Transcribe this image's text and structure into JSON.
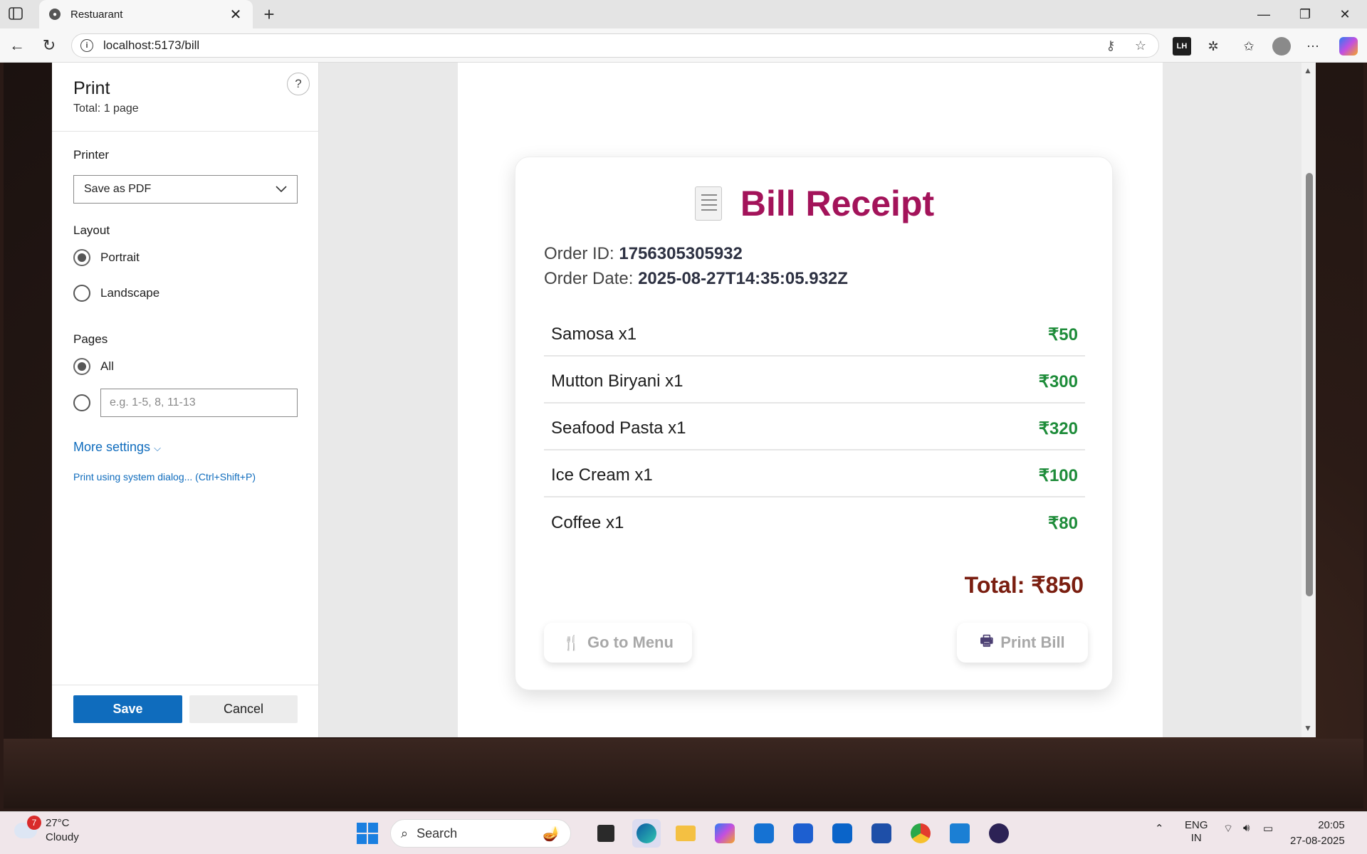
{
  "browser": {
    "tab_title": "Restuarant",
    "url": "localhost:5173/bill"
  },
  "print_panel": {
    "title": "Print",
    "total": "Total: 1 page",
    "help": "?",
    "printer_label": "Printer",
    "printer_value": "Save as PDF",
    "layout_label": "Layout",
    "layout_portrait": "Portrait",
    "layout_landscape": "Landscape",
    "pages_label": "Pages",
    "pages_all": "All",
    "pages_placeholder": "e.g. 1-5, 8, 11-13",
    "more_settings": "More settings",
    "system_dialog": "Print using system dialog... (Ctrl+Shift+P)",
    "save_label": "Save",
    "cancel_label": "Cancel"
  },
  "receipt": {
    "title": "Bill Receipt",
    "order_id_label": "Order ID:",
    "order_id": "1756305305932",
    "order_date_label": "Order Date:",
    "order_date": "2025-08-27T14:35:05.932Z",
    "items": [
      {
        "name": "Samosa x1",
        "price": "₹50"
      },
      {
        "name": "Mutton Biryani x1",
        "price": "₹300"
      },
      {
        "name": "Seafood Pasta x1",
        "price": "₹320"
      },
      {
        "name": "Ice Cream x1",
        "price": "₹100"
      },
      {
        "name": "Coffee x1",
        "price": "₹80"
      }
    ],
    "total": "Total: ₹850",
    "go_menu": "Go to Menu",
    "print_bill": "Print Bill",
    "colors": {
      "title": "#a3135a",
      "price": "#1e8c3a",
      "total": "#7a1e10"
    }
  },
  "taskbar": {
    "weather_temp": "27°C",
    "weather_desc": "Cloudy",
    "weather_badge": "7",
    "search": "Search",
    "lang_top": "ENG",
    "lang_bottom": "IN",
    "time": "20:05",
    "date": "27-08-2025"
  }
}
